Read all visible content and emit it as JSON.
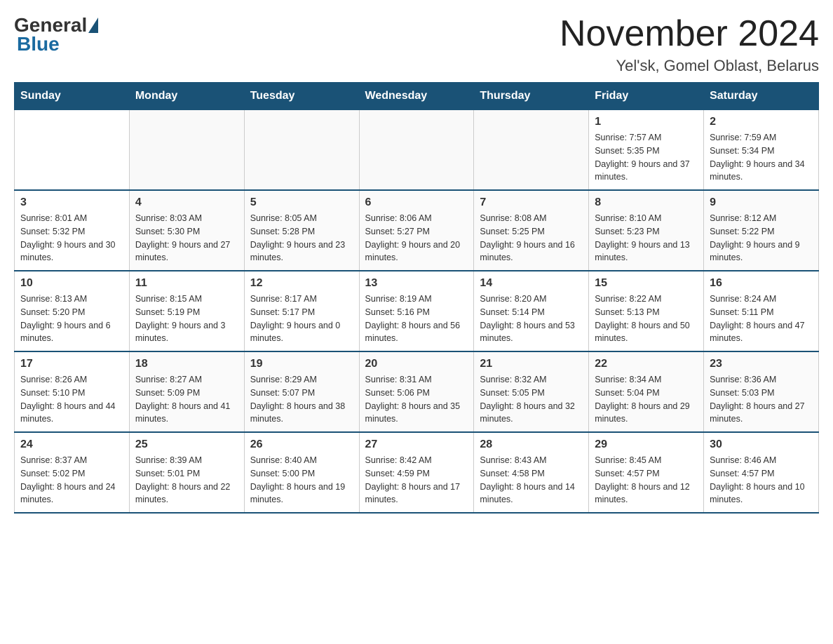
{
  "logo": {
    "general": "General",
    "blue": "Blue"
  },
  "title": "November 2024",
  "location": "Yel'sk, Gomel Oblast, Belarus",
  "days_of_week": [
    "Sunday",
    "Monday",
    "Tuesday",
    "Wednesday",
    "Thursday",
    "Friday",
    "Saturday"
  ],
  "weeks": [
    [
      {
        "day": "",
        "sunrise": "",
        "sunset": "",
        "daylight": ""
      },
      {
        "day": "",
        "sunrise": "",
        "sunset": "",
        "daylight": ""
      },
      {
        "day": "",
        "sunrise": "",
        "sunset": "",
        "daylight": ""
      },
      {
        "day": "",
        "sunrise": "",
        "sunset": "",
        "daylight": ""
      },
      {
        "day": "",
        "sunrise": "",
        "sunset": "",
        "daylight": ""
      },
      {
        "day": "1",
        "sunrise": "Sunrise: 7:57 AM",
        "sunset": "Sunset: 5:35 PM",
        "daylight": "Daylight: 9 hours and 37 minutes."
      },
      {
        "day": "2",
        "sunrise": "Sunrise: 7:59 AM",
        "sunset": "Sunset: 5:34 PM",
        "daylight": "Daylight: 9 hours and 34 minutes."
      }
    ],
    [
      {
        "day": "3",
        "sunrise": "Sunrise: 8:01 AM",
        "sunset": "Sunset: 5:32 PM",
        "daylight": "Daylight: 9 hours and 30 minutes."
      },
      {
        "day": "4",
        "sunrise": "Sunrise: 8:03 AM",
        "sunset": "Sunset: 5:30 PM",
        "daylight": "Daylight: 9 hours and 27 minutes."
      },
      {
        "day": "5",
        "sunrise": "Sunrise: 8:05 AM",
        "sunset": "Sunset: 5:28 PM",
        "daylight": "Daylight: 9 hours and 23 minutes."
      },
      {
        "day": "6",
        "sunrise": "Sunrise: 8:06 AM",
        "sunset": "Sunset: 5:27 PM",
        "daylight": "Daylight: 9 hours and 20 minutes."
      },
      {
        "day": "7",
        "sunrise": "Sunrise: 8:08 AM",
        "sunset": "Sunset: 5:25 PM",
        "daylight": "Daylight: 9 hours and 16 minutes."
      },
      {
        "day": "8",
        "sunrise": "Sunrise: 8:10 AM",
        "sunset": "Sunset: 5:23 PM",
        "daylight": "Daylight: 9 hours and 13 minutes."
      },
      {
        "day": "9",
        "sunrise": "Sunrise: 8:12 AM",
        "sunset": "Sunset: 5:22 PM",
        "daylight": "Daylight: 9 hours and 9 minutes."
      }
    ],
    [
      {
        "day": "10",
        "sunrise": "Sunrise: 8:13 AM",
        "sunset": "Sunset: 5:20 PM",
        "daylight": "Daylight: 9 hours and 6 minutes."
      },
      {
        "day": "11",
        "sunrise": "Sunrise: 8:15 AM",
        "sunset": "Sunset: 5:19 PM",
        "daylight": "Daylight: 9 hours and 3 minutes."
      },
      {
        "day": "12",
        "sunrise": "Sunrise: 8:17 AM",
        "sunset": "Sunset: 5:17 PM",
        "daylight": "Daylight: 9 hours and 0 minutes."
      },
      {
        "day": "13",
        "sunrise": "Sunrise: 8:19 AM",
        "sunset": "Sunset: 5:16 PM",
        "daylight": "Daylight: 8 hours and 56 minutes."
      },
      {
        "day": "14",
        "sunrise": "Sunrise: 8:20 AM",
        "sunset": "Sunset: 5:14 PM",
        "daylight": "Daylight: 8 hours and 53 minutes."
      },
      {
        "day": "15",
        "sunrise": "Sunrise: 8:22 AM",
        "sunset": "Sunset: 5:13 PM",
        "daylight": "Daylight: 8 hours and 50 minutes."
      },
      {
        "day": "16",
        "sunrise": "Sunrise: 8:24 AM",
        "sunset": "Sunset: 5:11 PM",
        "daylight": "Daylight: 8 hours and 47 minutes."
      }
    ],
    [
      {
        "day": "17",
        "sunrise": "Sunrise: 8:26 AM",
        "sunset": "Sunset: 5:10 PM",
        "daylight": "Daylight: 8 hours and 44 minutes."
      },
      {
        "day": "18",
        "sunrise": "Sunrise: 8:27 AM",
        "sunset": "Sunset: 5:09 PM",
        "daylight": "Daylight: 8 hours and 41 minutes."
      },
      {
        "day": "19",
        "sunrise": "Sunrise: 8:29 AM",
        "sunset": "Sunset: 5:07 PM",
        "daylight": "Daylight: 8 hours and 38 minutes."
      },
      {
        "day": "20",
        "sunrise": "Sunrise: 8:31 AM",
        "sunset": "Sunset: 5:06 PM",
        "daylight": "Daylight: 8 hours and 35 minutes."
      },
      {
        "day": "21",
        "sunrise": "Sunrise: 8:32 AM",
        "sunset": "Sunset: 5:05 PM",
        "daylight": "Daylight: 8 hours and 32 minutes."
      },
      {
        "day": "22",
        "sunrise": "Sunrise: 8:34 AM",
        "sunset": "Sunset: 5:04 PM",
        "daylight": "Daylight: 8 hours and 29 minutes."
      },
      {
        "day": "23",
        "sunrise": "Sunrise: 8:36 AM",
        "sunset": "Sunset: 5:03 PM",
        "daylight": "Daylight: 8 hours and 27 minutes."
      }
    ],
    [
      {
        "day": "24",
        "sunrise": "Sunrise: 8:37 AM",
        "sunset": "Sunset: 5:02 PM",
        "daylight": "Daylight: 8 hours and 24 minutes."
      },
      {
        "day": "25",
        "sunrise": "Sunrise: 8:39 AM",
        "sunset": "Sunset: 5:01 PM",
        "daylight": "Daylight: 8 hours and 22 minutes."
      },
      {
        "day": "26",
        "sunrise": "Sunrise: 8:40 AM",
        "sunset": "Sunset: 5:00 PM",
        "daylight": "Daylight: 8 hours and 19 minutes."
      },
      {
        "day": "27",
        "sunrise": "Sunrise: 8:42 AM",
        "sunset": "Sunset: 4:59 PM",
        "daylight": "Daylight: 8 hours and 17 minutes."
      },
      {
        "day": "28",
        "sunrise": "Sunrise: 8:43 AM",
        "sunset": "Sunset: 4:58 PM",
        "daylight": "Daylight: 8 hours and 14 minutes."
      },
      {
        "day": "29",
        "sunrise": "Sunrise: 8:45 AM",
        "sunset": "Sunset: 4:57 PM",
        "daylight": "Daylight: 8 hours and 12 minutes."
      },
      {
        "day": "30",
        "sunrise": "Sunrise: 8:46 AM",
        "sunset": "Sunset: 4:57 PM",
        "daylight": "Daylight: 8 hours and 10 minutes."
      }
    ]
  ]
}
